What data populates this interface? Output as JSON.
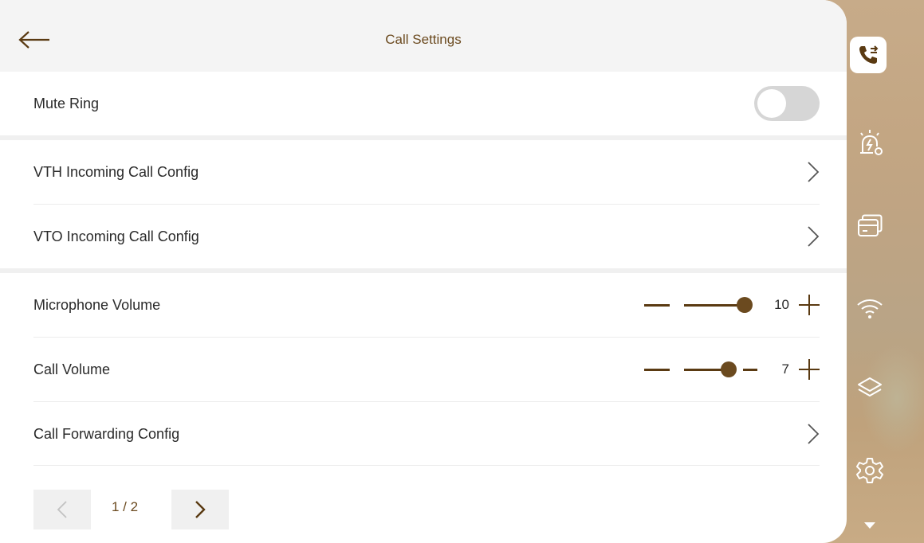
{
  "header": {
    "title": "Call Settings",
    "back_icon": "arrow-left-icon"
  },
  "rows": {
    "mute_ring": {
      "label": "Mute Ring",
      "enabled": false
    },
    "vth_incoming": {
      "label": "VTH Incoming Call Config"
    },
    "vto_incoming": {
      "label": "VTO Incoming Call Config"
    },
    "mic_volume": {
      "label": "Microphone Volume",
      "value": "10",
      "max": 10
    },
    "call_volume": {
      "label": "Call Volume",
      "value": "7",
      "max": 10
    },
    "call_forwarding": {
      "label": "Call Forwarding Config"
    }
  },
  "pager": {
    "text": "1 / 2",
    "current": 1,
    "total": 2
  },
  "sidebar": {
    "items": [
      {
        "icon": "call-settings-icon",
        "active": true
      },
      {
        "icon": "alarm-settings-icon",
        "active": false
      },
      {
        "icon": "card-settings-icon",
        "active": false
      },
      {
        "icon": "wifi-icon",
        "active": false
      },
      {
        "icon": "layers-icon",
        "active": false
      },
      {
        "icon": "gear-icon",
        "active": false
      },
      {
        "icon": "triangle-down-icon",
        "active": false
      }
    ]
  },
  "colors": {
    "accent": "#6b4a1f",
    "toggle_off": "#d6d6d6",
    "header_bg": "#f4f4f4"
  }
}
